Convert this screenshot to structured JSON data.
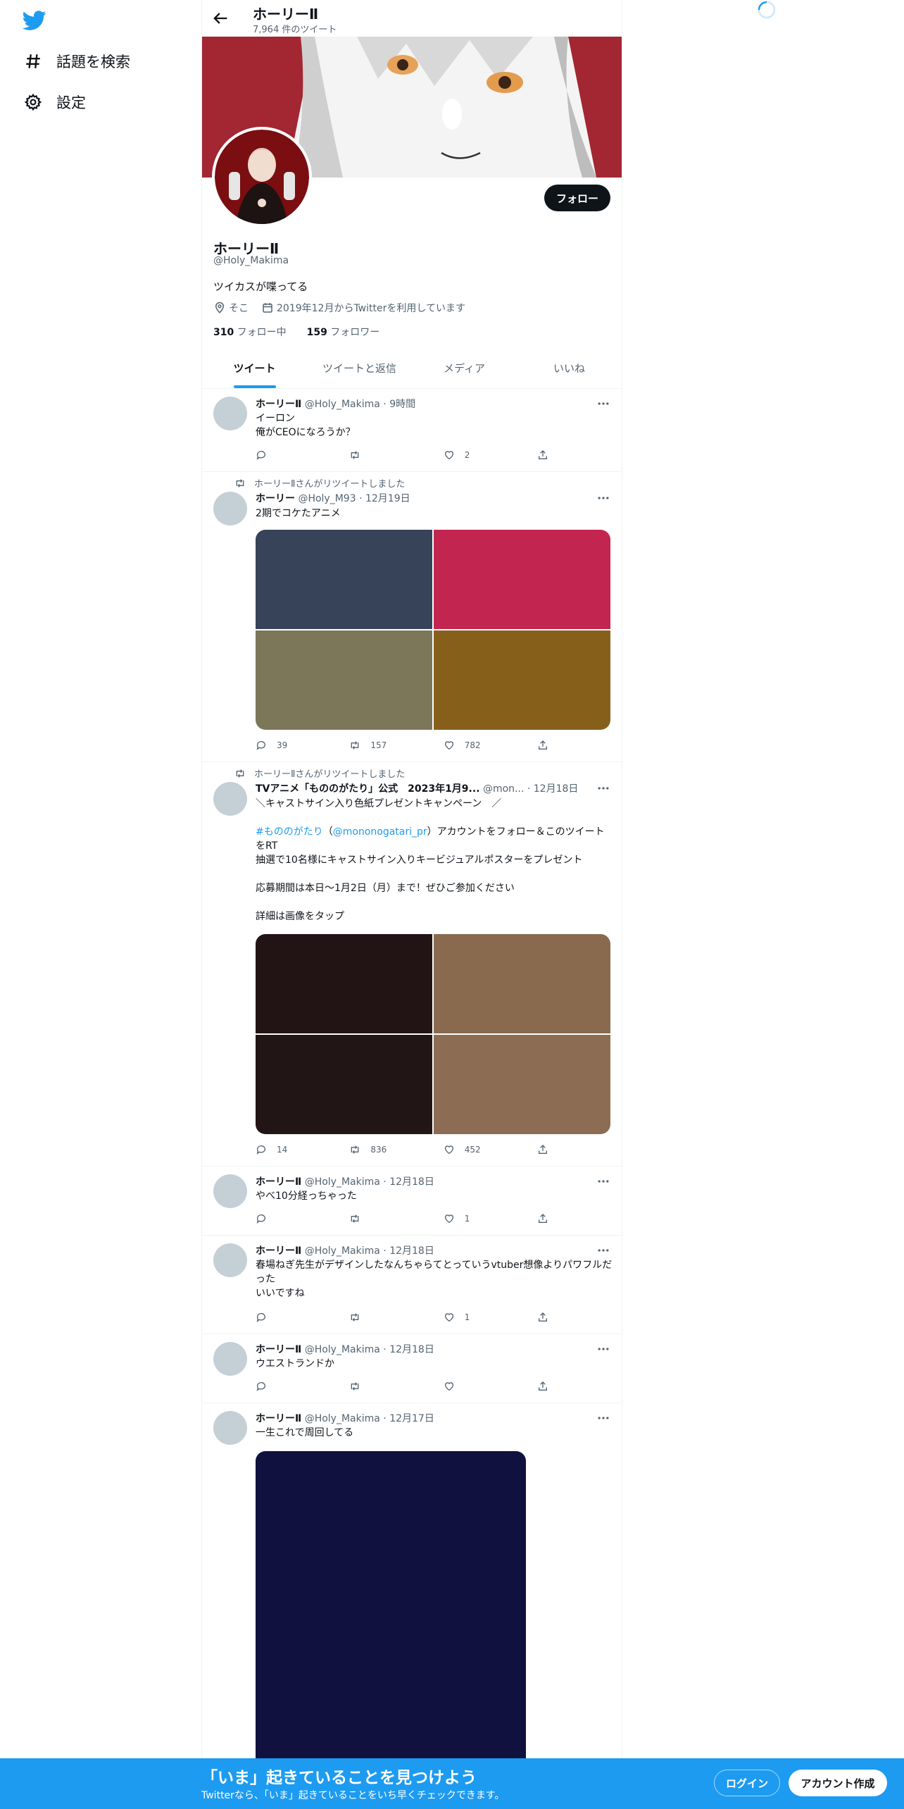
{
  "nav": {
    "logo": "twitter-bird-icon",
    "explore_label": "話題を検索",
    "settings_label": "設定"
  },
  "header": {
    "title": "ホーリーⅡ",
    "tweet_count": "7,964 件のツイート"
  },
  "profile": {
    "follow_label": "フォロー",
    "name": "ホーリーⅡ",
    "handle": "@Holy_Makima",
    "bio": "ツイカスが喋ってる",
    "location": "そこ",
    "joined": "2019年12月からTwitterを利用しています",
    "following_count": "310",
    "following_label": " フォロー中",
    "followers_count": "159",
    "followers_label": " フォロワー"
  },
  "tabs": [
    "ツイート",
    "ツイートと返信",
    "メディア",
    "いいね"
  ],
  "tweets": [
    {
      "name": "ホーリーⅡ",
      "handle": "@Holy_Makima",
      "dot": " · ",
      "time": "9時間",
      "text": "イーロン\n俺がCEOになろうか？",
      "reply": "",
      "retweet": "",
      "like": "2"
    },
    {
      "retweeted_by": "ホーリーⅡさんがリツイートしました",
      "name": "ホーリー",
      "handle": "@Holy_M93",
      "dot": " · ",
      "time": "12月19日",
      "text": "2期でコケたアニメ",
      "media_colors": [
        "#374359",
        "#c2254f",
        "#7d775a",
        "#86601b"
      ],
      "reply": "39",
      "retweet": "157",
      "like": "782"
    },
    {
      "retweeted_by": "ホーリーⅡさんがリツイートしました",
      "name": "TVアニメ「もののがたり」公式　2023年1月9...",
      "handle": "@mon...",
      "dot": " · ",
      "time": "12月18日",
      "text_line1": "＼キャストサイン入り色紙プレゼントキャンペーン　／",
      "hashtag": "#もののがたり",
      "mention_open": "（",
      "mention": "@mononogatari_pr",
      "text_mid": "）アカウントをフォロー＆このツイートをRT\n抽選で10名様にキャストサイン入りキービジュアルポスターをプレゼント\n\n応募期間は本日〜1月2日（月）まで！ぜひご参加ください\n\n詳細は画像をタップ",
      "media_colors": [
        "#221415",
        "#8a6a4f",
        "#221515",
        "#8c6c52"
      ],
      "reply": "14",
      "retweet": "836",
      "like": "452"
    },
    {
      "name": "ホーリーⅡ",
      "handle": "@Holy_Makima",
      "dot": " · ",
      "time": "12月18日",
      "text": "やべ10分経っちゃった",
      "reply": "",
      "retweet": "",
      "like": "1"
    },
    {
      "name": "ホーリーⅡ",
      "handle": "@Holy_Makima",
      "dot": " · ",
      "time": "12月18日",
      "text": "春場ねぎ先生がデザインしたなんちゃらてとっていうvtuber想像よりパワフルだった\nいいですね",
      "reply": "",
      "retweet": "",
      "like": "1"
    },
    {
      "name": "ホーリーⅡ",
      "handle": "@Holy_Makima",
      "dot": " · ",
      "time": "12月18日",
      "text": "ウエストランドか",
      "reply": "",
      "retweet": "",
      "like": ""
    },
    {
      "name": "ホーリーⅡ",
      "handle": "@Holy_Makima",
      "dot": " · ",
      "time": "12月17日",
      "text": "一生これで周回してる",
      "media_color": "#11113f"
    }
  ],
  "bottom_bar": {
    "title": "「いま」起きていることを見つけよう",
    "subtitle": "Twitterなら、「いま」起きていることをいち早くチェックできます。",
    "login_label": "ログイン",
    "signup_label": "アカウント作成"
  },
  "colors": {
    "accent": "#1d9bf0",
    "banner": "#a32633",
    "text": "#0f1419",
    "muted": "#536471"
  }
}
